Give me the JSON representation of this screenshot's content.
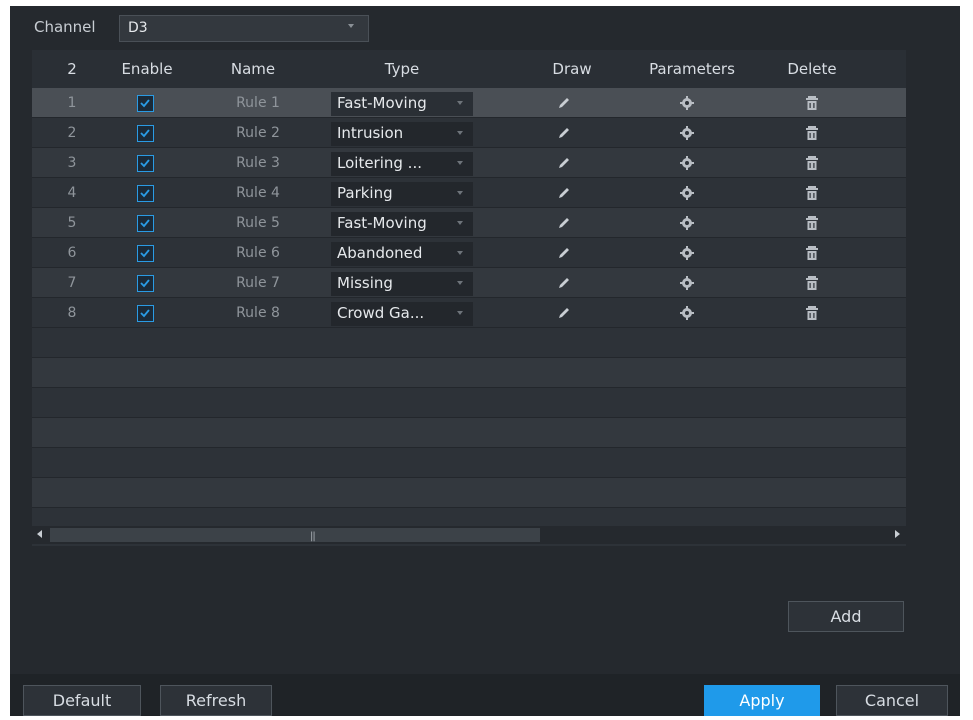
{
  "channel": {
    "label": "Channel",
    "value": "D3"
  },
  "table": {
    "headers": {
      "count": "2",
      "enable": "Enable",
      "name": "Name",
      "type": "Type",
      "draw": "Draw",
      "parameters": "Parameters",
      "delete": "Delete"
    },
    "rows": [
      {
        "num": "1",
        "enabled": true,
        "name": "Rule 1",
        "type": "Fast-Moving"
      },
      {
        "num": "2",
        "enabled": true,
        "name": "Rule 2",
        "type": "Intrusion"
      },
      {
        "num": "3",
        "enabled": true,
        "name": "Rule 3",
        "type": "Loitering ..."
      },
      {
        "num": "4",
        "enabled": true,
        "name": "Rule 4",
        "type": "Parking"
      },
      {
        "num": "5",
        "enabled": true,
        "name": "Rule 5",
        "type": "Fast-Moving"
      },
      {
        "num": "6",
        "enabled": true,
        "name": "Rule 6",
        "type": "Abandoned"
      },
      {
        "num": "7",
        "enabled": true,
        "name": "Rule 7",
        "type": "Missing"
      },
      {
        "num": "8",
        "enabled": true,
        "name": "Rule 8",
        "type": "Crowd Ga..."
      }
    ],
    "selected_row": 1
  },
  "buttons": {
    "add": "Add",
    "default": "Default",
    "refresh": "Refresh",
    "apply": "Apply",
    "cancel": "Cancel"
  },
  "colors": {
    "accent": "#1f9aea",
    "panel_bg": "#25292e"
  },
  "icons": {
    "draw": "pencil-icon",
    "parameters": "gear-icon",
    "delete": "trash-icon",
    "enable": "checkbox-checked-icon"
  }
}
